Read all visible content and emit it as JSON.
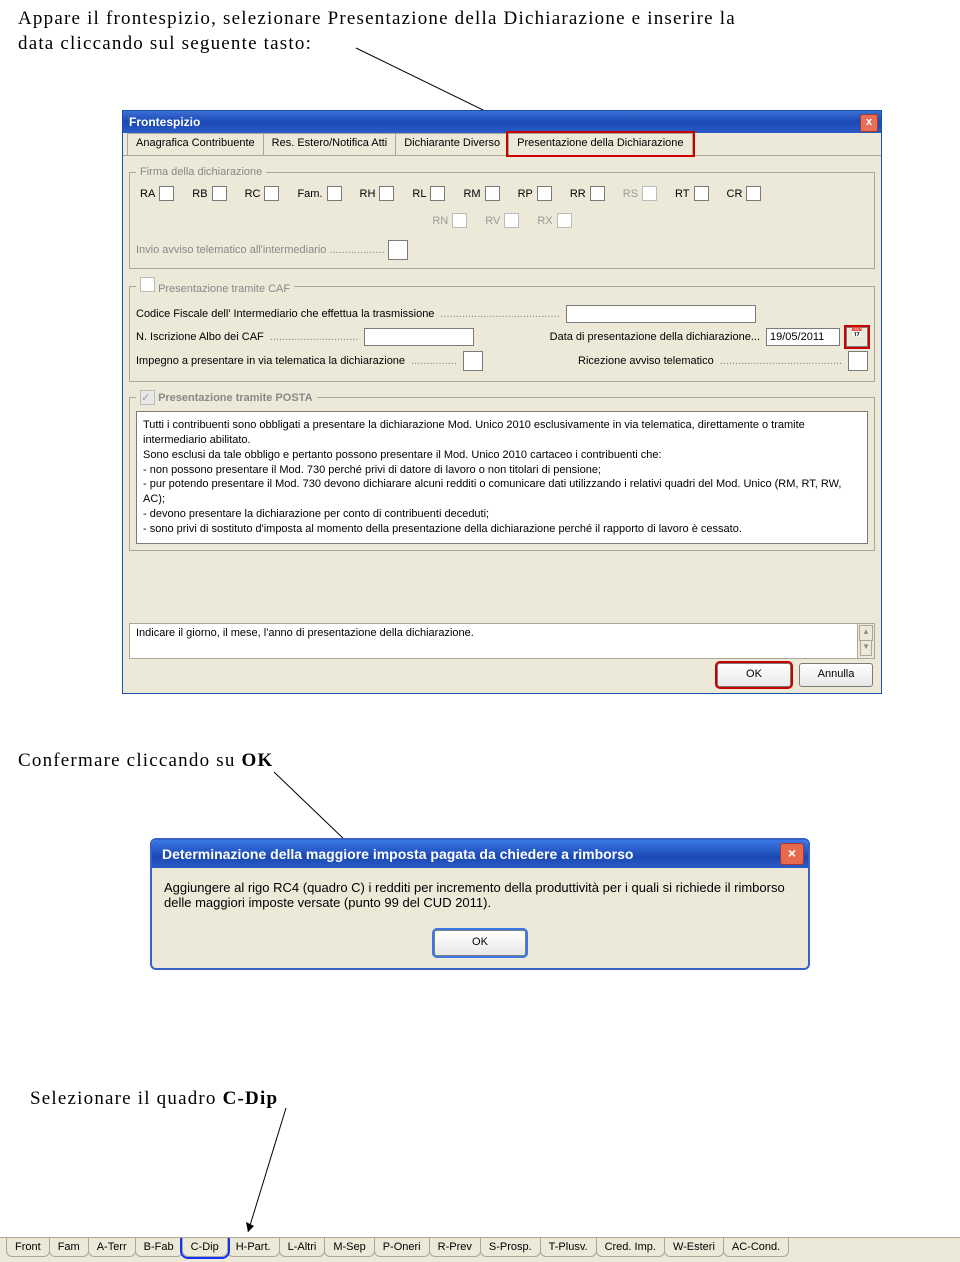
{
  "instructions": {
    "line1": "Appare il frontespizio, selezionare Presentazione della Dichiarazione e inserire la",
    "line2": "data cliccando sul seguente tasto:",
    "line3_pre": "Confermare cliccando su ",
    "line3_bold": "OK",
    "line4_pre": "Selezionare il quadro ",
    "line4_bold": "C-Dip"
  },
  "window1": {
    "title": "Frontespizio",
    "tabs": [
      "Anagrafica Contribuente",
      "Res. Estero/Notifica Atti",
      "Dichiarante Diverso",
      "Presentazione della Dichiarazione"
    ],
    "firma_legend": "Firma della dichiarazione",
    "checks1": [
      "RA",
      "RB",
      "RC",
      "Fam.",
      "RH",
      "RL",
      "RM",
      "RP",
      "RR",
      "RS",
      "RT",
      "CR"
    ],
    "checks2": [
      "RN",
      "RV",
      "RX"
    ],
    "invio_label": "Invio avviso telematico all'intermediario",
    "caf_legend": "Presentazione tramite CAF",
    "cf_label": "Codice Fiscale dell' Intermediario che effettua la trasmissione",
    "albo_label": "N. Iscrizione Albo dei CAF",
    "data_label": "Data di presentazione della dichiarazione...",
    "data_value": "19/05/2011",
    "impegno_label": "Impegno a presentare in via telematica la dichiarazione",
    "ricezione_label": "Ricezione avviso telematico",
    "posta_legend": "Presentazione tramite POSTA",
    "posta_text": "Tutti i contribuenti sono obbligati a presentare la dichiarazione Mod. Unico 2010 esclusivamente in via telematica, direttamente o tramite intermediario abilitato.\nSono esclusi da tale obbligo e pertanto possono presentare il Mod. Unico 2010 cartaceo i contribuenti che:\n- non possono presentare il Mod. 730 perché privi di datore di lavoro o non titolari di pensione;\n- pur potendo presentare il Mod. 730 devono dichiarare alcuni redditi o comunicare dati utilizzando i relativi quadri del Mod. Unico (RM, RT, RW, AC);\n- devono presentare la dichiarazione per conto di contribuenti deceduti;\n- sono privi di sostituto d'imposta al momento della presentazione della dichiarazione perché il rapporto di lavoro è cessato.",
    "status_text": "Indicare il giorno, il mese, l'anno di presentazione della dichiarazione.",
    "ok": "OK",
    "annulla": "Annulla"
  },
  "dialog": {
    "title": "Determinazione della maggiore imposta pagata da chiedere a rimborso",
    "body": "Aggiungere al rigo RC4 (quadro C) i redditi per incremento della produttività per i quali si richiede il rimborso delle maggiori imposte versate (punto 99 del CUD 2011).",
    "ok": "OK"
  },
  "bottom_tabs": [
    "Front",
    "Fam",
    "A-Terr",
    "B-Fab",
    "C-Dip",
    "H-Part.",
    "L-Altri",
    "M-Sep",
    "P-Oneri",
    "R-Prev",
    "S-Prosp.",
    "T-Plusv.",
    "Cred. Imp.",
    "W-Esteri",
    "AC-Cond."
  ]
}
